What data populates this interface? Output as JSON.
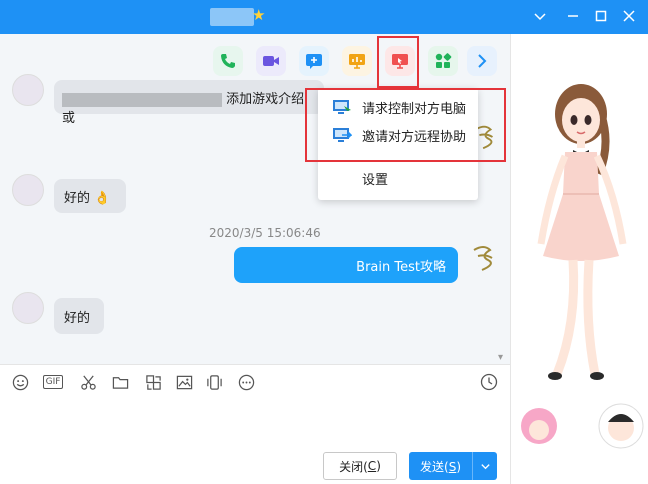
{
  "window": {
    "minimize_glyph": "—",
    "maximize_glyph": "☐",
    "close_glyph": "✕",
    "dropdown_glyph": "⌄"
  },
  "toolbar": {
    "icons": [
      "phone-icon",
      "video-icon",
      "add-message-icon",
      "screen-share-icon",
      "remote-desktop-icon",
      "apps-icon",
      "more-arrow-icon"
    ]
  },
  "messages": [
    {
      "side": "left",
      "text_tail": "添加游戏介绍或"
    },
    {
      "side": "left",
      "text": "好的",
      "emoji": "👌"
    },
    {
      "side": "right",
      "text_tail": "Brain Test攻略"
    },
    {
      "side": "left",
      "text": "好的"
    }
  ],
  "timestamp": "2020/3/5 15:06:46",
  "remote_menu": {
    "items": [
      {
        "label": "请求控制对方电脑",
        "icon": "remote-control-icon"
      },
      {
        "label": "邀请对方远程协助",
        "icon": "remote-assist-icon"
      },
      {
        "label": "设置"
      }
    ]
  },
  "input_toolbar": {
    "gif_label": "GIF",
    "icons": [
      "emoji-icon",
      "gif-icon",
      "scissors-icon",
      "folder-icon",
      "image-edit-icon",
      "image-icon",
      "shake-icon",
      "more-icon"
    ]
  },
  "buttons": {
    "close_text": "关闭(",
    "close_key": "C",
    "close_suffix": ")",
    "send_text": "发送(",
    "send_key": "S",
    "send_suffix": ")",
    "send_arrow": "⌄"
  },
  "colors": {
    "accent": "#1e91f5",
    "highlight": "#e4343a",
    "bubble_right": "#1ea2fa",
    "bubble_left": "#e2e5ea"
  }
}
